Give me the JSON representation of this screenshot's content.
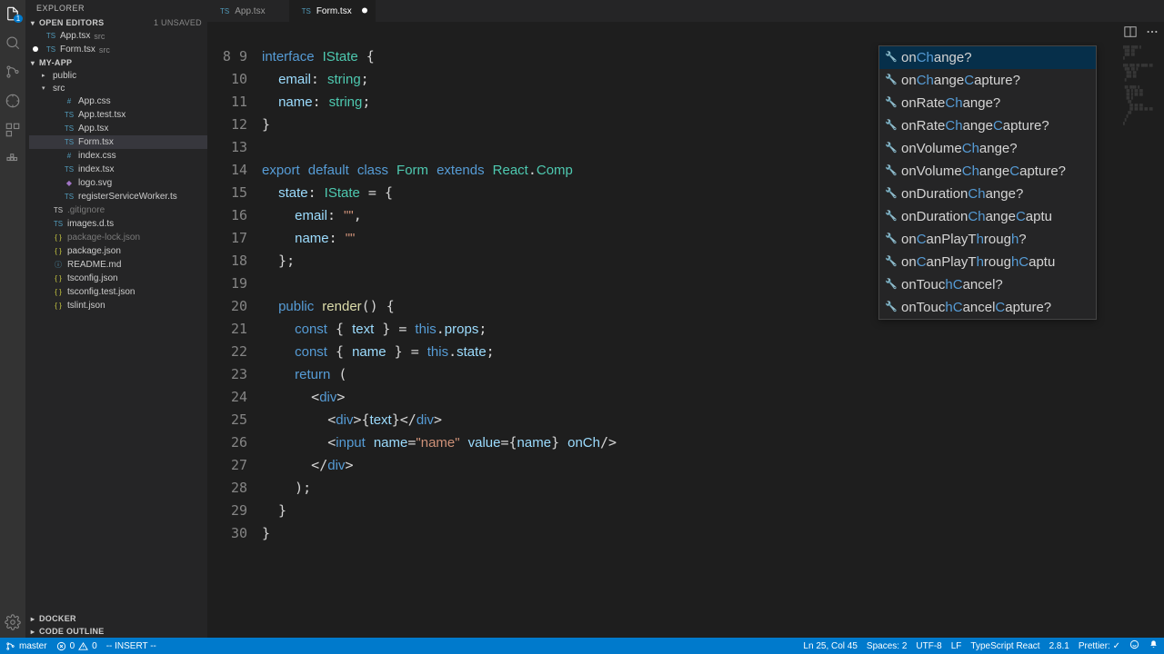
{
  "sidebar": {
    "title": "EXPLORER",
    "openEditorsLabel": "OPEN EDITORS",
    "openEditorsHint": "1 UNSAVED",
    "openEditors": [
      {
        "name": "App.tsx",
        "hint": "src",
        "modified": false
      },
      {
        "name": "Form.tsx",
        "hint": "src",
        "modified": true
      }
    ],
    "projectLabel": "MY-APP",
    "tree": [
      {
        "name": "public",
        "kind": "folder",
        "depth": 0,
        "open": false
      },
      {
        "name": "src",
        "kind": "folder",
        "depth": 0,
        "open": true
      },
      {
        "name": "App.css",
        "kind": "css",
        "depth": 1
      },
      {
        "name": "App.test.tsx",
        "kind": "ts",
        "depth": 1
      },
      {
        "name": "App.tsx",
        "kind": "ts",
        "depth": 1
      },
      {
        "name": "Form.tsx",
        "kind": "ts",
        "depth": 1,
        "active": true
      },
      {
        "name": "index.css",
        "kind": "css",
        "depth": 1
      },
      {
        "name": "index.tsx",
        "kind": "ts",
        "depth": 1
      },
      {
        "name": "logo.svg",
        "kind": "svg",
        "depth": 1
      },
      {
        "name": "registerServiceWorker.ts",
        "kind": "ts",
        "depth": 1
      },
      {
        "name": ".gitignore",
        "kind": "file",
        "depth": 0,
        "muted": true
      },
      {
        "name": "images.d.ts",
        "kind": "ts",
        "depth": 0
      },
      {
        "name": "package-lock.json",
        "kind": "json",
        "depth": 0,
        "muted": true
      },
      {
        "name": "package.json",
        "kind": "json",
        "depth": 0
      },
      {
        "name": "README.md",
        "kind": "md",
        "depth": 0
      },
      {
        "name": "tsconfig.json",
        "kind": "json",
        "depth": 0
      },
      {
        "name": "tsconfig.test.json",
        "kind": "json",
        "depth": 0
      },
      {
        "name": "tslint.json",
        "kind": "json",
        "depth": 0
      }
    ],
    "bottomSections": [
      "DOCKER",
      "CODE OUTLINE"
    ]
  },
  "tabs": [
    {
      "label": "App.tsx",
      "active": false,
      "modified": false
    },
    {
      "label": "Form.tsx",
      "active": true,
      "modified": true
    }
  ],
  "code": {
    "first_line_no": 8,
    "last_line_no": 30
  },
  "suggestions": [
    "onChange?",
    "onChangeCapture?",
    "onRateChange?",
    "onRateChangeCapture?",
    "onVolumeChange?",
    "onVolumeChangeCapture?",
    "onDurationChange?",
    "onDurationChangeCaptu",
    "onCanPlayThrough?",
    "onCanPlayThroughCaptu",
    "onTouchCancel?",
    "onTouchCancelCapture?"
  ],
  "suggestion_match": "Ch",
  "status": {
    "branch": "master",
    "sync": "",
    "errors": "0",
    "warnings": "0",
    "mode": "-- INSERT --",
    "cursor": "Ln 25, Col 45",
    "spaces": "Spaces: 2",
    "encoding": "UTF-8",
    "eol": "LF",
    "language": "TypeScript React",
    "tsver": "2.8.1",
    "formatter": "Prettier: ✓"
  }
}
